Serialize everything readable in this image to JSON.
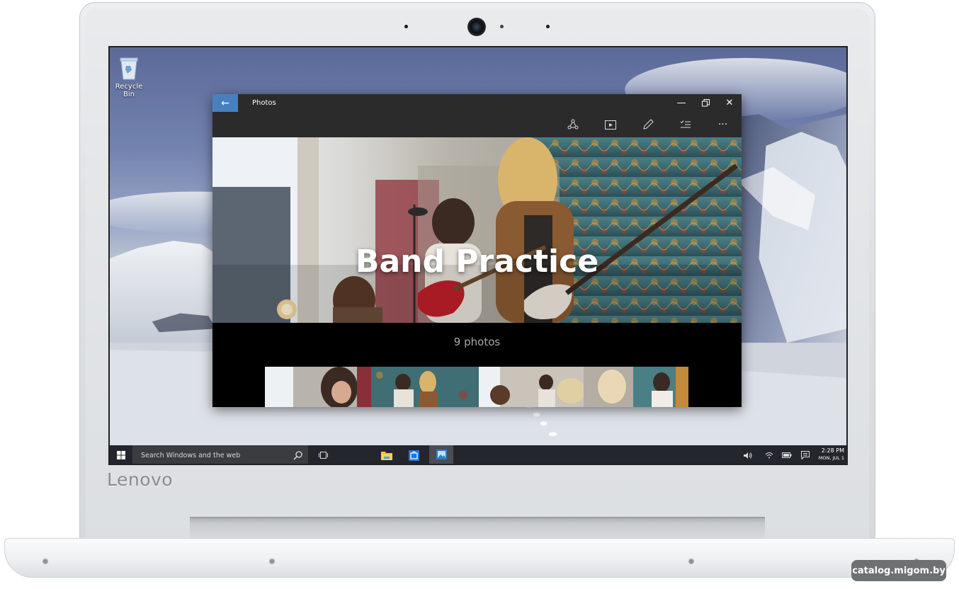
{
  "desktop": {
    "recycle_bin_label": "Recycle Bin"
  },
  "photos_window": {
    "title": "Photos",
    "back_icon": "arrow-left-icon",
    "caption_buttons": [
      "minimize-icon",
      "restore-icon",
      "close-icon"
    ],
    "toolbar_icons": [
      "share-icon",
      "slideshow-icon",
      "edit-icon",
      "select-icon",
      "more-icon"
    ],
    "album_title": "Band Practice",
    "photo_count": "9 photos"
  },
  "taskbar": {
    "search_placeholder": "Search Windows and the web",
    "clock_time": "2:28 PM",
    "clock_date": "MON, JUL 1",
    "pinned": [
      "file-explorer-icon",
      "store-icon",
      "photos-icon"
    ],
    "tray": [
      "volume-icon",
      "wifi-icon",
      "battery-icon",
      "action-center-icon"
    ]
  },
  "device": {
    "brand": "Lenovo"
  },
  "watermark": "catalog.migom.by",
  "colors": {
    "accent": "#4a7fbf",
    "window_chrome": "#2b2b2b",
    "taskbar": "#16181c"
  }
}
